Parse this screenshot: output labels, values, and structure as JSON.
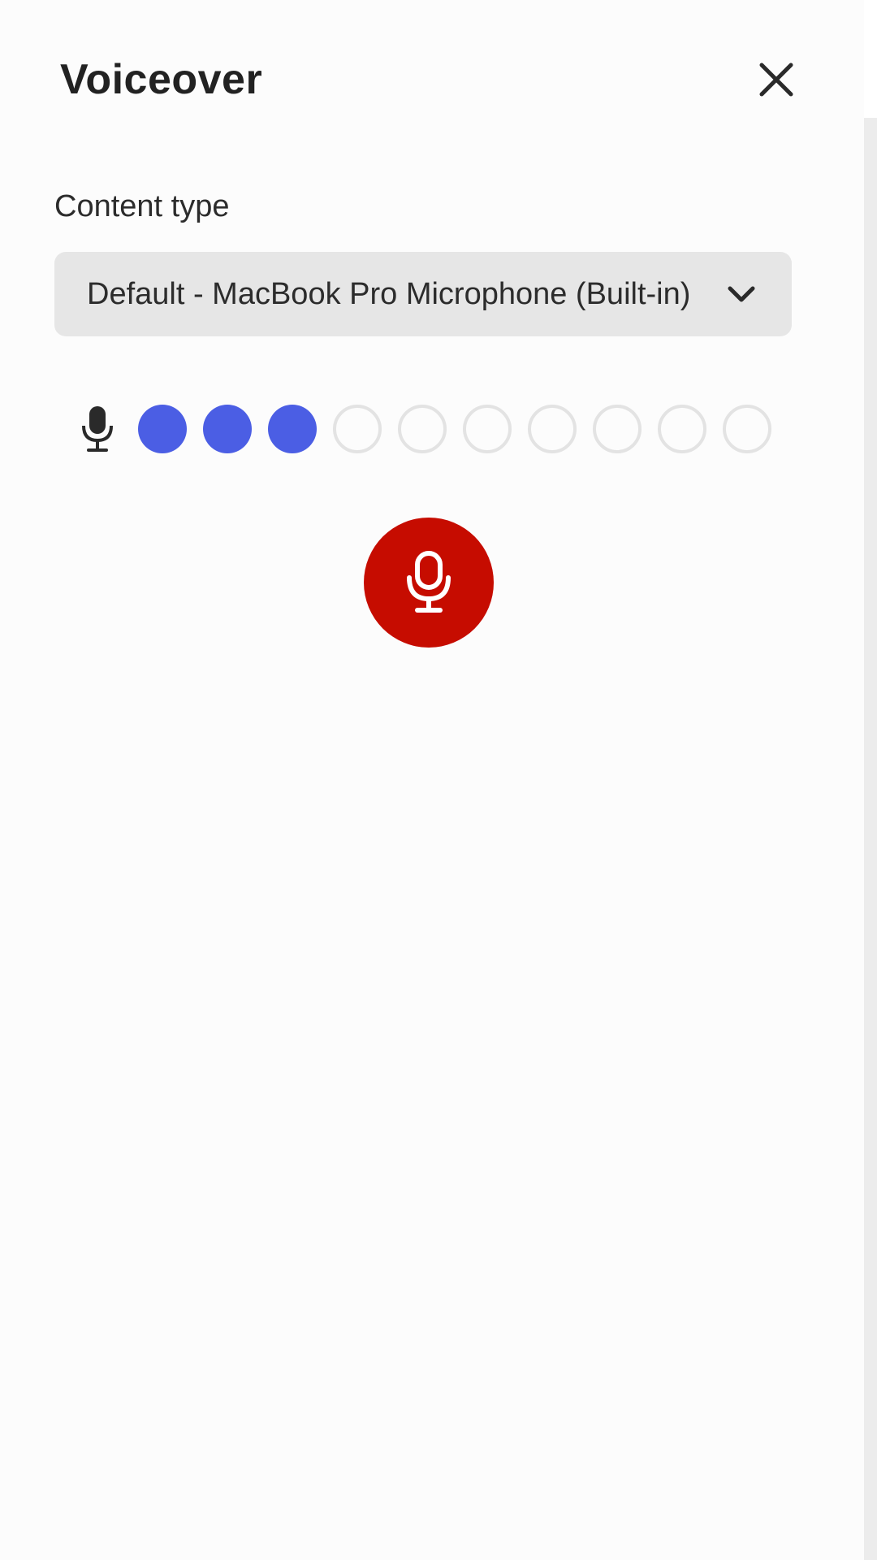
{
  "panel": {
    "title": "Voiceover",
    "close_icon": "close-icon"
  },
  "content_type": {
    "label": "Content type",
    "selected": "Default - MacBook Pro Microphone (Built-in)",
    "chevron_icon": "chevron-down-icon"
  },
  "level_meter": {
    "icon": "microphone-icon",
    "total_segments": 10,
    "active_segments": 3,
    "active_color": "#4b5ee4",
    "inactive_color": "#e3e3e3"
  },
  "record_button": {
    "icon": "microphone-icon",
    "color": "#c60c00"
  }
}
